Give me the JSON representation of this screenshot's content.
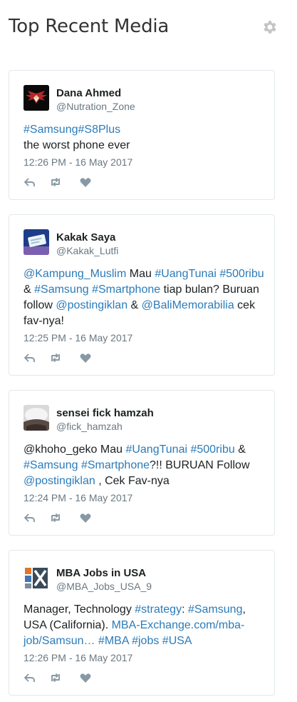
{
  "header": {
    "title": "Top Recent Media",
    "settings_icon": "gear-icon"
  },
  "colors": {
    "link": "#2b7bb9",
    "meta": "#697882",
    "icon": "#8899a6",
    "border": "#e1e8ed"
  },
  "tweets": [
    {
      "name": "Dana Ahmed",
      "handle": "@Nutration_Zone",
      "text": [
        {
          "t": "#Samsung",
          "link": true
        },
        {
          "t": "#S8Plus",
          "link": true
        },
        {
          "t": "\nthe worst phone ever",
          "link": false
        }
      ],
      "time": "12:26 PM - 16 May 2017"
    },
    {
      "name": "Kakak Saya",
      "handle": "@Kakak_Lutfi",
      "text": [
        {
          "t": "@Kampung_Muslim",
          "link": true
        },
        {
          "t": " Mau ",
          "link": false
        },
        {
          "t": "#UangTunai",
          "link": true
        },
        {
          "t": " ",
          "link": false
        },
        {
          "t": "#500ribu",
          "link": true
        },
        {
          "t": " & ",
          "link": false
        },
        {
          "t": "#Samsung",
          "link": true
        },
        {
          "t": " ",
          "link": false
        },
        {
          "t": "#Smartphone",
          "link": true
        },
        {
          "t": " tiap bulan? Buruan follow ",
          "link": false
        },
        {
          "t": "@postingiklan",
          "link": true
        },
        {
          "t": " & ",
          "link": false
        },
        {
          "t": "@BaliMemorabilia",
          "link": true
        },
        {
          "t": " cek fav-nya!",
          "link": false
        }
      ],
      "time": "12:25 PM - 16 May 2017"
    },
    {
      "name": "sensei fick hamzah",
      "handle": "@fick_hamzah",
      "text": [
        {
          "t": "@khoho_geko Mau ",
          "link": false
        },
        {
          "t": "#UangTunai",
          "link": true
        },
        {
          "t": " ",
          "link": false
        },
        {
          "t": "#500ribu",
          "link": true
        },
        {
          "t": " & ",
          "link": false
        },
        {
          "t": "#Samsung",
          "link": true
        },
        {
          "t": " ",
          "link": false
        },
        {
          "t": "#Smartphone",
          "link": true
        },
        {
          "t": "?!! BURUAN Follow ",
          "link": false
        },
        {
          "t": "@postingiklan",
          "link": true
        },
        {
          "t": " , Cek Fav-nya",
          "link": false
        }
      ],
      "time": "12:24 PM - 16 May 2017"
    },
    {
      "name": "MBA Jobs in USA",
      "handle": "@MBA_Jobs_USA_9",
      "text": [
        {
          "t": "Manager, Technology ",
          "link": false
        },
        {
          "t": "#strategy",
          "link": true
        },
        {
          "t": ": ",
          "link": false
        },
        {
          "t": "#Samsung",
          "link": true
        },
        {
          "t": ", USA (California). ",
          "link": false
        },
        {
          "t": "MBA-Exchange.com/mba-job/Samsun…",
          "link": true
        },
        {
          "t": " ",
          "link": false
        },
        {
          "t": "#MBA",
          "link": true
        },
        {
          "t": " ",
          "link": false
        },
        {
          "t": "#jobs",
          "link": true
        },
        {
          "t": " ",
          "link": false
        },
        {
          "t": "#USA",
          "link": true
        }
      ],
      "time": "12:26 PM - 16 May 2017"
    }
  ],
  "action_icons": [
    "reply-icon",
    "retweet-icon",
    "like-icon"
  ]
}
